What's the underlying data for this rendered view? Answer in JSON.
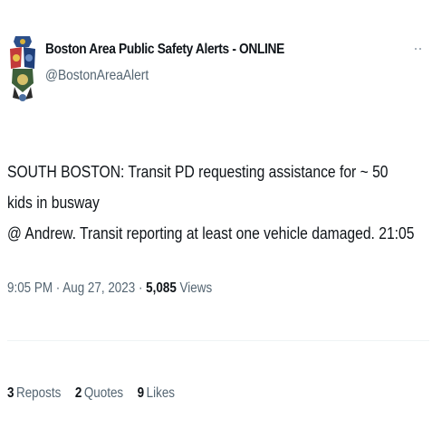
{
  "author": {
    "display_name": "Boston Area Public Safety Alerts - ONLINE",
    "handle": "@BostonAreaAlert",
    "avatar_icon": "police-badges-avatar-icon"
  },
  "more_icon": "more-options-icon",
  "tweet": {
    "text": "SOUTH BOSTON: Transit PD requesting assistance for ~ 50 kids in busway\n@ Andrew. Transit reporting at least one vehicle damaged. 21:05"
  },
  "meta": {
    "time": "9:05 PM",
    "sep1": " · ",
    "date": "Aug 27, 2023",
    "sep2": " · ",
    "views_count": "5,085",
    "views_label": "Views"
  },
  "stats": {
    "reposts_count": "3",
    "reposts_label": "Reposts",
    "quotes_count": "2",
    "quotes_label": "Quotes",
    "likes_count": "9",
    "likes_label": "Likes"
  },
  "colors": {
    "text_primary": "#0f1419",
    "text_secondary": "#536471",
    "divider": "#eff3f4"
  }
}
